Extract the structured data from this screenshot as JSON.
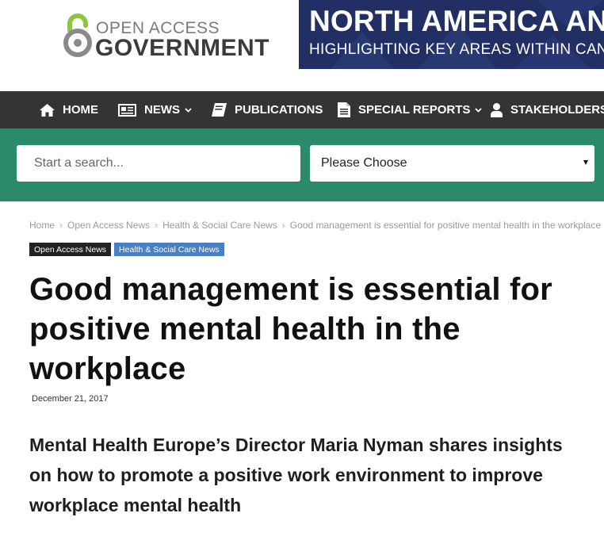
{
  "header": {
    "logo": {
      "line1": "OPEN ACCESS",
      "line2": "GOVERNMENT"
    },
    "banner": {
      "title": "NORTH AMERICA AN",
      "subtitle": "HIGHLIGHTING KEY AREAS WITHIN CANADA"
    }
  },
  "nav": {
    "items": [
      {
        "label": "HOME",
        "icon": "home-icon",
        "dropdown": false
      },
      {
        "label": "NEWS",
        "icon": "newspaper-icon",
        "dropdown": true
      },
      {
        "label": "PUBLICATIONS",
        "icon": "book-icon",
        "dropdown": false
      },
      {
        "label": "SPECIAL REPORTS",
        "icon": "document-icon",
        "dropdown": true
      },
      {
        "label": "STAKEHOLDERS",
        "icon": "user-icon",
        "dropdown": true
      }
    ]
  },
  "search": {
    "placeholder": "Start a search...",
    "select_value": "Please Choose"
  },
  "article": {
    "breadcrumb": [
      "Home",
      "Open Access News",
      "Health & Social Care News",
      "Good management is essential for positive mental health in the workplace"
    ],
    "tags": [
      "Open Access News",
      "Health & Social Care News"
    ],
    "title": "Good management is essential for positive mental health in the workplace",
    "date": "December 21, 2017",
    "lede": "Mental Health Europe’s Director Maria Nyman shares insights on how to promote a positive work environment to improve workplace mental health"
  },
  "colors": {
    "nav_bg": "#343434",
    "search_bg": "#2a8a6a",
    "banner_bg": "#1e2a5a",
    "logo_green": "#8cc63f",
    "tag_dark": "#222222",
    "tag_blue": "#4a7fc1"
  }
}
